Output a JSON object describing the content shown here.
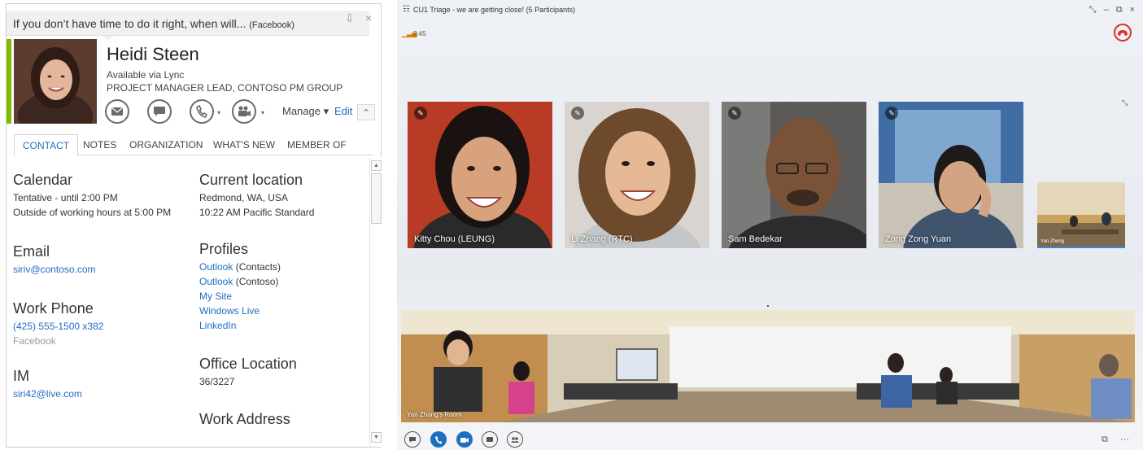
{
  "card": {
    "status_message": "If you don’t have time to do it right, when will...",
    "status_source": "(Facebook)",
    "pin_glyph": "⇩",
    "close_glyph": "×",
    "name": "Heidi Steen",
    "availability": "Available via Lync",
    "job_title": "PROJECT MANAGER LEAD, CONTOSO PM GROUP",
    "manage_label": "Manage ▾",
    "edit_label": "Edit",
    "collapse_glyph": "⌃",
    "tabs": [
      "CONTACT",
      "NOTES",
      "ORGANIZATION",
      "WHAT'S NEW",
      "MEMBER OF"
    ],
    "calendar": {
      "heading": "Calendar",
      "line1": "Tentative - until 2:00 PM",
      "line2": "Outside of working hours at 5:00 PM"
    },
    "email": {
      "heading": "Email",
      "value": "siriv@contoso.com"
    },
    "work_phone": {
      "heading": "Work Phone",
      "value": "(425) 555-1500 x382",
      "source": "Facebook"
    },
    "im": {
      "heading": "IM",
      "value": "siri42@live.com"
    },
    "current_location": {
      "heading": "Current location",
      "line1": "Redmond, WA, USA",
      "line2": "10:22 AM Pacific Standard"
    },
    "profiles": {
      "heading": "Profiles",
      "items": [
        {
          "link": "Outlook",
          "suffix": " (Contacts)"
        },
        {
          "link": "Outlook",
          "suffix": " (Contoso)"
        },
        {
          "link": "My Site",
          "suffix": ""
        },
        {
          "link": "Windows Live",
          "suffix": ""
        },
        {
          "link": "LinkedIn",
          "suffix": ""
        }
      ]
    },
    "office_location": {
      "heading": "Office Location",
      "value": "36/3227"
    },
    "work_address": {
      "heading": "Work Address"
    },
    "presence_color": "#7fba00",
    "link_color": "#1e6fc2"
  },
  "conference": {
    "window_title": "CU1 Triage - we are getting close! (5 Participants)",
    "call_time": "3:45",
    "window_controls": [
      "⤡",
      "–",
      "⧉",
      "×"
    ],
    "participants": [
      {
        "name": "Kitty Chou (LEUNG)"
      },
      {
        "name": "Li Zhang (RTC)"
      },
      {
        "name": "Sam Bedekar"
      },
      {
        "name": "Zong Zong Yuan"
      }
    ],
    "small_tile_name": "Yan Zhong",
    "room_name": "Yan Zhong's Room",
    "more_glyph": "···",
    "hangup_color": "#d93025",
    "accent_color": "#1e6fc2"
  }
}
